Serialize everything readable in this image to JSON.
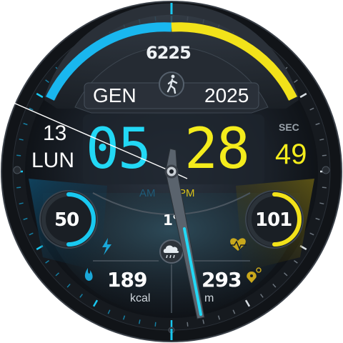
{
  "colors": {
    "accent_cyan": "#19c8f0",
    "accent_yellow": "#f2e21a",
    "bezel": "#0e1013",
    "dial": "#1a2028"
  },
  "steps": {
    "value": "6225",
    "icon": "walking-person-icon",
    "progress_percent": 50
  },
  "date": {
    "month": "GEN",
    "year": "2025",
    "day": "13",
    "weekday": "LUN"
  },
  "time": {
    "hours": "05",
    "minutes": "28",
    "seconds": "49",
    "seconds_label": "SEC",
    "am": "AM",
    "pm": "PM",
    "active_period": "PM"
  },
  "battery": {
    "value": "50",
    "percent": 50,
    "icon": "lightning-bolt-icon"
  },
  "heart_rate": {
    "value": "101",
    "icon": "heart-pulse-icon"
  },
  "weather": {
    "temperature": "1°",
    "icon": "cloud-rain-icon"
  },
  "calories": {
    "value": "189",
    "unit": "kcal",
    "icon": "flame-icon"
  },
  "distance": {
    "value": "293",
    "unit": "m",
    "icon": "location-pin-icon"
  }
}
